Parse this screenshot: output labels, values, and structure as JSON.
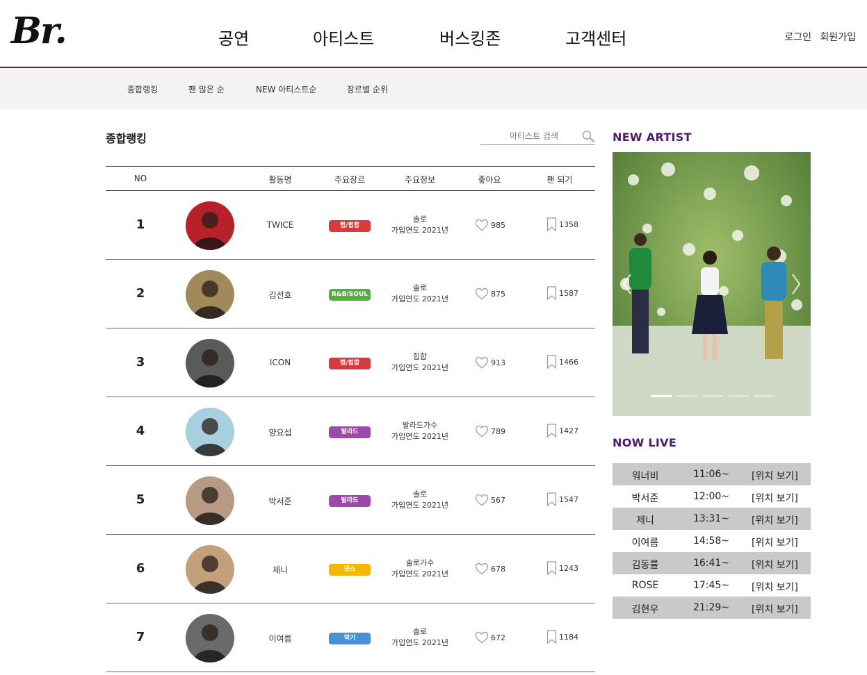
{
  "header": {
    "logo": "Br.",
    "nav": [
      "공연",
      "아티스트",
      "버스킹존",
      "고객센터"
    ],
    "login": "로그인",
    "signup": "회원가입"
  },
  "subnav": [
    "종합랭킹",
    "팬 많은 순",
    "NEW 아티스트순",
    "장르별 순위"
  ],
  "ranking": {
    "title": "종합랭킹",
    "search_placeholder": "아티스트 검색",
    "columns": [
      "NO",
      "활동명",
      "주요장르",
      "주요정보",
      "좋아요",
      "팬 되기"
    ],
    "rows": [
      {
        "no": "1",
        "name": "TWICE",
        "genre": "랩/힙합",
        "genre_color": "#d93a3a",
        "info1": "솔로",
        "info2": "가입연도 2021년",
        "likes": "985",
        "fans": "1358",
        "avatar_color": "#b8202a"
      },
      {
        "no": "2",
        "name": "김선호",
        "genre": "R&B/SOUL",
        "genre_color": "#5aa84a",
        "info1": "솔로",
        "info2": "가입연도 2021년",
        "likes": "875",
        "fans": "1587",
        "avatar_color": "#a08a5a"
      },
      {
        "no": "3",
        "name": "ICON",
        "genre": "랩/힙합",
        "genre_color": "#d93a3a",
        "info1": "힙합",
        "info2": "가입연도 2021년",
        "likes": "913",
        "fans": "1466",
        "avatar_color": "#5a5a5a"
      },
      {
        "no": "4",
        "name": "양요섭",
        "genre": "발라드",
        "genre_color": "#9b4aa8",
        "info1": "발라드가수",
        "info2": "가입연도 2021년",
        "likes": "789",
        "fans": "1427",
        "avatar_color": "#a8cfe0"
      },
      {
        "no": "5",
        "name": "박서준",
        "genre": "발라드",
        "genre_color": "#9b4aa8",
        "info1": "솔로",
        "info2": "가입연도 2021년",
        "likes": "567",
        "fans": "1547",
        "avatar_color": "#b89a84"
      },
      {
        "no": "6",
        "name": "제니",
        "genre": "댄스",
        "genre_color": "#f5b800",
        "info1": "솔로가수",
        "info2": "가입연도 2021년",
        "likes": "678",
        "fans": "1243",
        "avatar_color": "#c4a07a"
      },
      {
        "no": "7",
        "name": "이여름",
        "genre": "악기",
        "genre_color": "#4a90d9",
        "info1": "솔로",
        "info2": "가입연도 2021년",
        "likes": "672",
        "fans": "1184",
        "avatar_color": "#6a6a6a"
      }
    ]
  },
  "side": {
    "new_artist_title": "NEW ARTIST",
    "now_live_title": "NOW LIVE",
    "live": [
      {
        "name": "워너비",
        "time": "11:06~",
        "link": "[위치 보기]"
      },
      {
        "name": "박서준",
        "time": "12:00~",
        "link": "[위치 보기]"
      },
      {
        "name": "제니",
        "time": "13:31~",
        "link": "[위치 보기]"
      },
      {
        "name": "이여름",
        "time": "14:58~",
        "link": "[위치 보기]"
      },
      {
        "name": "김동률",
        "time": "16:41~",
        "link": "[위치 보기]"
      },
      {
        "name": "ROSE",
        "time": "17:45~",
        "link": "[위치 보기]"
      },
      {
        "name": "김현우",
        "time": "21:29~",
        "link": "[위치 보기]"
      }
    ]
  },
  "colors": {
    "accent": "#4b1c6b",
    "live_shade": "#c9c9c9"
  }
}
